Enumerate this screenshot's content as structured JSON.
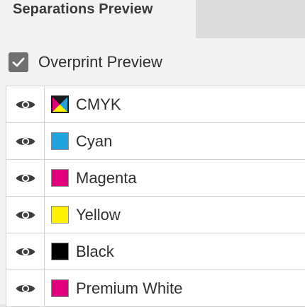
{
  "panel": {
    "tab_title": "Separations Preview"
  },
  "overprint": {
    "label": "Overprint Preview",
    "checked": true
  },
  "separations": [
    {
      "name": "CMYK",
      "swatch": "cmyk",
      "visible": true
    },
    {
      "name": "Cyan",
      "swatch": "#1fa3dc",
      "visible": true
    },
    {
      "name": "Magenta",
      "swatch": "#e2007a",
      "visible": true
    },
    {
      "name": "Yellow",
      "swatch": "#fff200",
      "visible": true
    },
    {
      "name": "Black",
      "swatch": "#000000",
      "visible": true
    },
    {
      "name": "Premium White",
      "swatch": "#e2007a",
      "visible": true
    }
  ],
  "icons": {
    "visibility": "eye-icon",
    "checkbox": "checkmark-icon"
  },
  "colors": {
    "active_tab_bg": "#f3f3f3",
    "inactive_tab_bg": "#dcdcdc",
    "checkbox_bg": "#707070"
  }
}
